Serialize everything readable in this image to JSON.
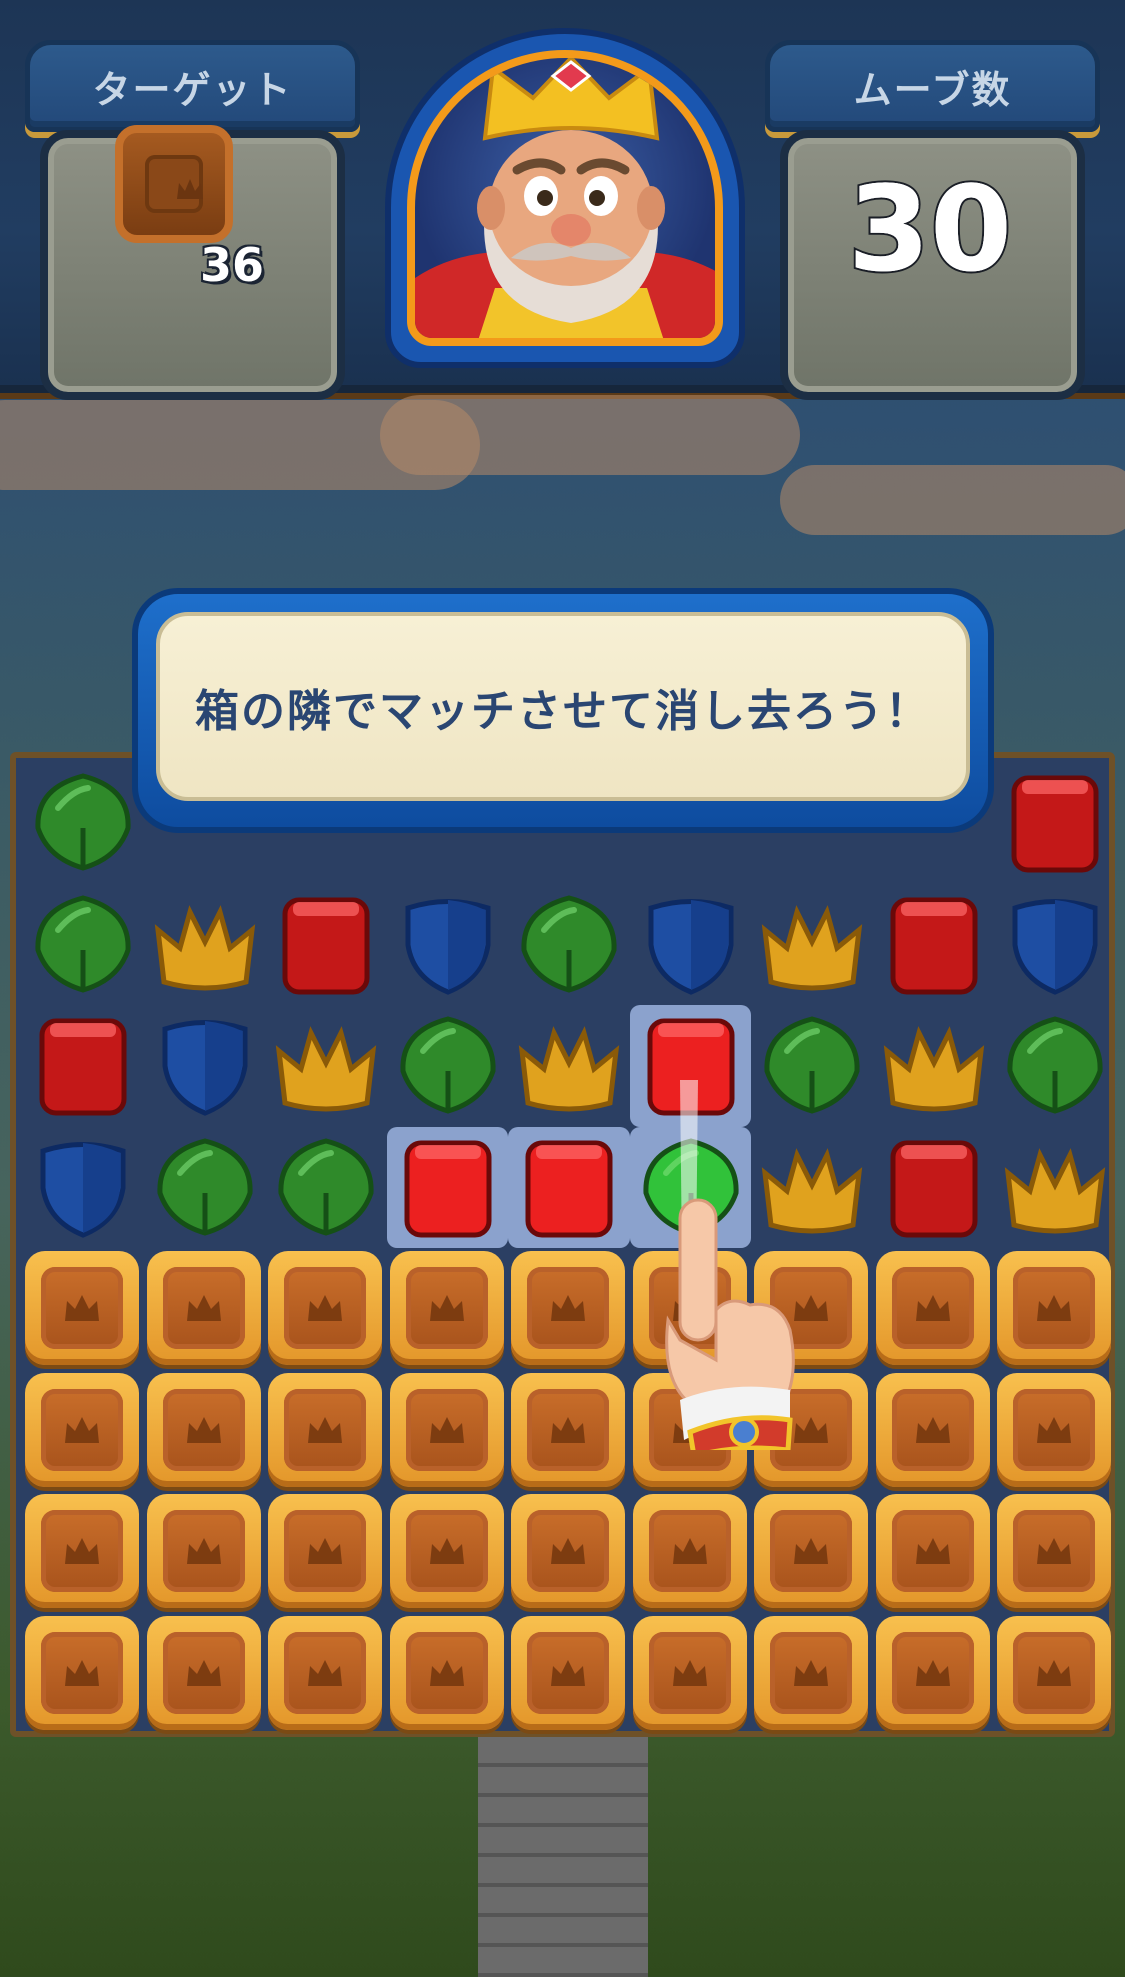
{
  "hud": {
    "target_label": "ターゲット",
    "target_icon": "wooden-crate-icon",
    "target_count": "36",
    "moves_label": "ムーブ数",
    "moves_count": "30",
    "portrait": "king-portrait"
  },
  "tutorial": {
    "message": "箱の隣でマッチさせて消し去ろう！",
    "pointer_icon": "pointing-hand-icon"
  },
  "board": {
    "columns": 9,
    "rows": 8,
    "tile_legend": {
      "G": "green-leaf",
      "B": "blue-shield",
      "R": "red-book",
      "Y": "yellow-crown",
      "C": "wooden-crate",
      "_": "hidden-by-tooltip"
    },
    "rows_data": [
      [
        "G",
        "_",
        "_",
        "_",
        "_",
        "_",
        "_",
        "_",
        "R"
      ],
      [
        "G",
        "Y",
        "R",
        "B",
        "G",
        "B",
        "Y",
        "R",
        "B"
      ],
      [
        "R",
        "B",
        "Y",
        "G",
        "Y",
        "R",
        "G",
        "Y",
        "G"
      ],
      [
        "B",
        "G",
        "G",
        "R",
        "R",
        "G",
        "Y",
        "R",
        "Y"
      ],
      [
        "C",
        "C",
        "C",
        "C",
        "C",
        "C",
        "C",
        "C",
        "C"
      ],
      [
        "C",
        "C",
        "C",
        "C",
        "C",
        "C",
        "C",
        "C",
        "C"
      ],
      [
        "C",
        "C",
        "C",
        "C",
        "C",
        "C",
        "C",
        "C",
        "C"
      ],
      [
        "C",
        "C",
        "C",
        "C",
        "C",
        "C",
        "C",
        "C",
        "C"
      ]
    ],
    "highlighted_cells": [
      [
        2,
        5
      ],
      [
        3,
        3
      ],
      [
        3,
        4
      ],
      [
        3,
        5
      ]
    ],
    "colors": {
      "green": "#2f8a2a",
      "blue": "#1e4ea3",
      "red": "#c41818",
      "yellow": "#e0a21e",
      "crate": "#f0a83a"
    }
  }
}
